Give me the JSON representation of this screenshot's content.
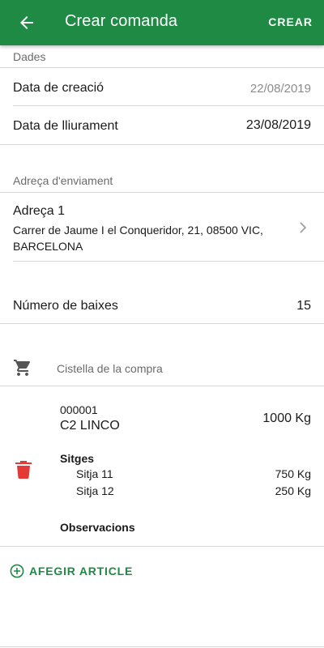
{
  "appbar": {
    "title": "Crear comanda",
    "action": "CREAR",
    "color": "#1e8a43"
  },
  "dades": {
    "section_label": "Dades",
    "creation_label": "Data de creació",
    "creation_value": "22/08/2019",
    "delivery_label": "Data de lliurament",
    "delivery_value": "23/08/2019"
  },
  "shipping": {
    "section_label": "Adreça d'enviament",
    "name": "Adreça 1",
    "address": "Carrer de Jaume I el Conqueridor, 21, 08500 VIC, BARCELONA"
  },
  "baixes": {
    "label": "Número de baixes",
    "value": "15"
  },
  "cart": {
    "label": "Cistella de la compra",
    "items": [
      {
        "code": "000001",
        "name": "C2 LINCO",
        "quantity": "1000 Kg",
        "sitges_title": "Sitges",
        "sitges": [
          {
            "name": "Sitja 11",
            "qty": "750 Kg"
          },
          {
            "name": "Sitja 12",
            "qty": "250 Kg"
          }
        ],
        "observations_title": "Observacions"
      }
    ]
  },
  "add_article": {
    "label": "AFEGIR ARTICLE"
  },
  "icons": {
    "back": "arrow-left-icon",
    "chevron": "chevron-right-icon",
    "cart": "shopping-cart-icon",
    "delete": "trash-icon",
    "add": "plus-circle-icon"
  },
  "colors": {
    "accent": "#1e8a43",
    "danger": "#e53935"
  }
}
